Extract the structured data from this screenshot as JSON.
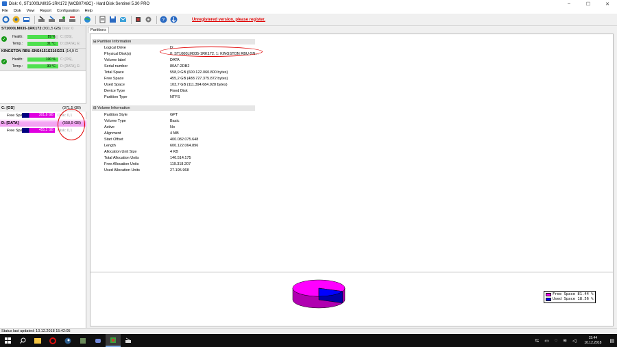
{
  "window": {
    "title": "Disk: 0, ST1000LM035-1RK172 [WCB07X8C]  -  Hard Disk Sentinel 5.30 PRO",
    "min": "–",
    "max": "☐",
    "close": "✕"
  },
  "menu": [
    "File",
    "Disk",
    "View",
    "Report",
    "Configuration",
    "Help"
  ],
  "toolbar": {
    "unregistered": "Unregistered version, please register."
  },
  "disks": [
    {
      "name": "ST1000LM035-1RK172",
      "size": "(931,5 GB)",
      "disknum": "Disk: 0",
      "health_label": "Health:",
      "health": "89 %",
      "health_extra": "C: [OS],",
      "temp_label": "Temp.:",
      "temp": "31 °C",
      "temp_extra": "D: [DATA], E:",
      "health_fill": 0.89
    },
    {
      "name": "KINGSTON RBU-SNS4151S316GD1",
      "size": "(14,9 G",
      "disknum": "",
      "health_label": "Health:",
      "health": "100 %",
      "health_extra": "C: [OS],",
      "temp_label": "Temp.:",
      "temp": "30 °C",
      "temp_extra": "D: [DATA], E:",
      "health_fill": 1.0
    }
  ],
  "volumes": [
    {
      "name": "C: [OS]",
      "size": "(371,5 GB)",
      "fs_label": "Free Space",
      "free": "301,8 GB",
      "disk": "Disk: 0,1"
    },
    {
      "name": "D: [DATA]",
      "size": "(558,9 GB)",
      "fs_label": "Free Space",
      "free": "455,2 GB",
      "disk": "Disk: 0,1"
    }
  ],
  "tab": "Partitions",
  "partition_info": {
    "title": "Partition Information",
    "rows": [
      [
        "Logical Drive",
        "D:"
      ],
      [
        "Physical Disk(s)",
        "0: ST1000LM035-1RK172, 1: KINGSTON RBU-SN..."
      ],
      [
        "Volume label",
        "DATA"
      ],
      [
        "Serial number",
        "80A7-2DB2"
      ],
      [
        "Total Space",
        "558,9 GB (600.122.060.800 bytes)"
      ],
      [
        "Free Space",
        "455,2 GB (488.727.375.872 bytes)"
      ],
      [
        "Used Space",
        "103,7 GB (111.394.684.928 bytes)"
      ],
      [
        "Device Type",
        "Fixed Disk"
      ],
      [
        "Partition Type",
        "NTFS"
      ]
    ]
  },
  "volume_info": {
    "title": "Volume Information",
    "rows": [
      [
        "Partition Style",
        "GPT"
      ],
      [
        "Volume Type",
        "Basic"
      ],
      [
        "Active",
        "No"
      ],
      [
        "Alignment",
        "4 MB"
      ],
      [
        "Start Offset",
        "400.082.075.648"
      ],
      [
        "Length",
        "600.122.064.896"
      ],
      [
        "Allocation Unit Size",
        "4 KB"
      ],
      [
        "Total Allocation Units",
        "146.514.175"
      ],
      [
        "Free Allocation Units",
        "119.318.207"
      ],
      [
        "Used Allocation Units",
        "27.195.968"
      ]
    ]
  },
  "chart_data": {
    "type": "pie",
    "categories": [
      "Free Space",
      "Used Space"
    ],
    "values": [
      81.44,
      18.56
    ],
    "colors": [
      "#ff00ff",
      "#0000ff"
    ],
    "legend": [
      "Free Space 81.44 %",
      "Used Space 18.56 %"
    ],
    "legend_position": "right"
  },
  "status": "Status last updated: 10.12.2018 15:42:05",
  "taskbar": {
    "time": "15:44",
    "date": "10.12.2018"
  }
}
